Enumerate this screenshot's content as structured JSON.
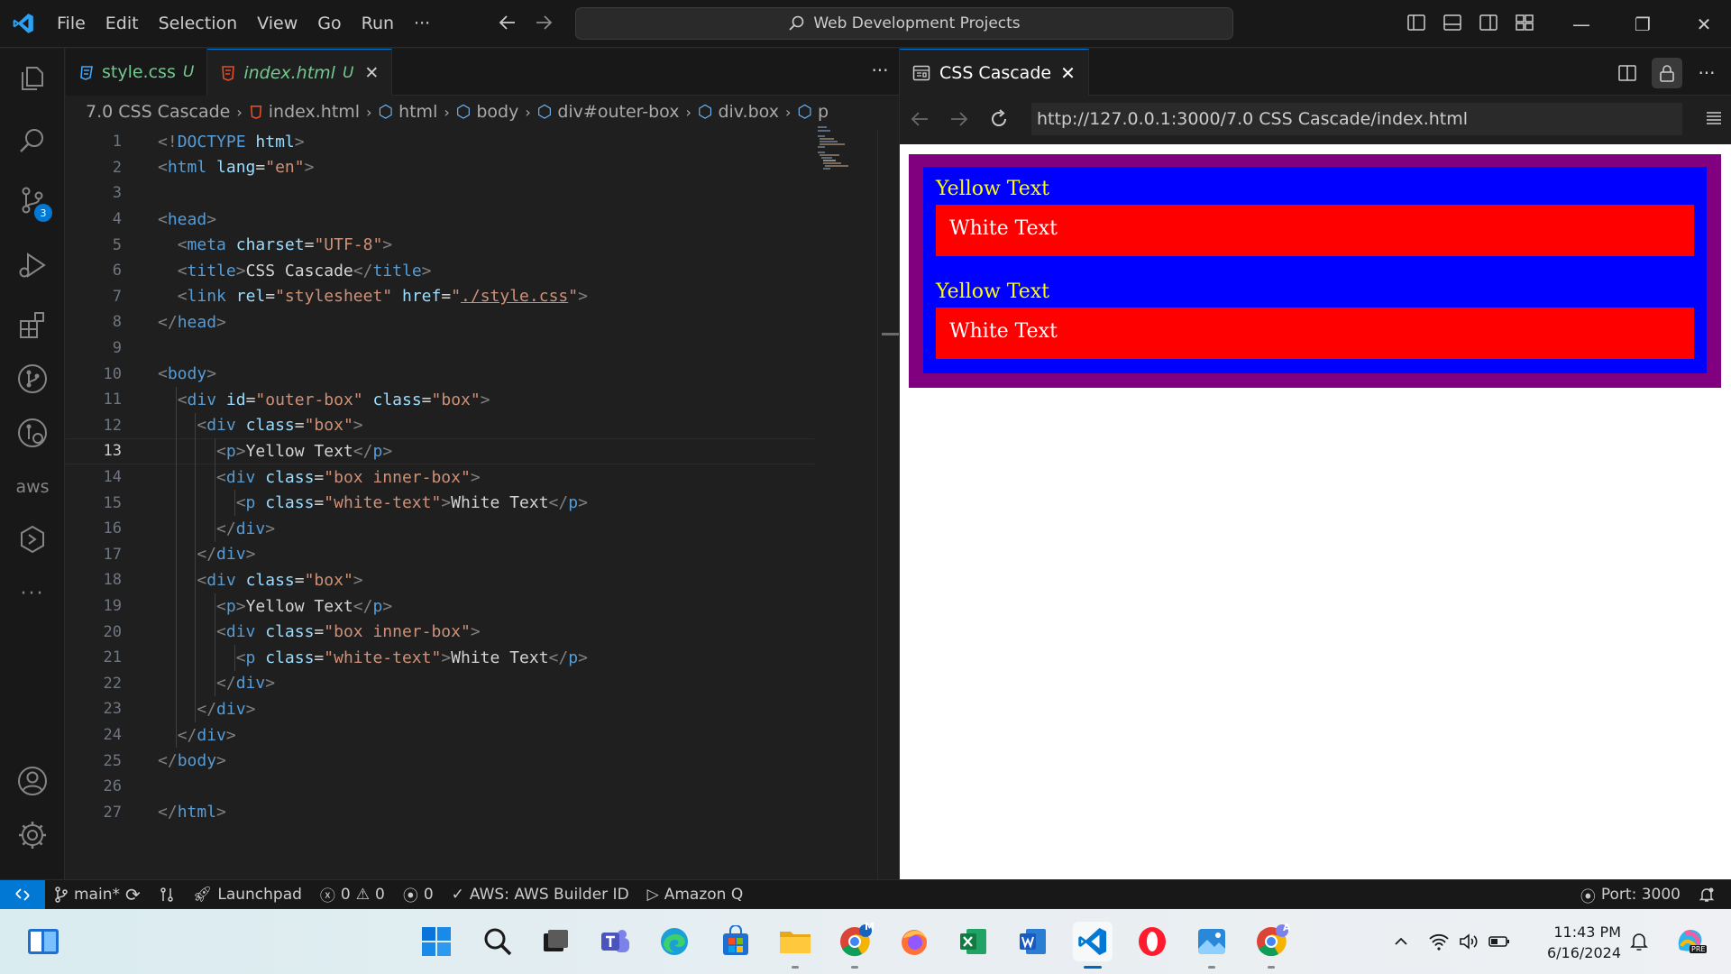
{
  "titlebar": {
    "menu": [
      "File",
      "Edit",
      "Selection",
      "View",
      "Go",
      "Run",
      "···"
    ],
    "command_center": "Web Development Projects"
  },
  "activity_bar": {
    "items": [
      "explorer-icon",
      "search-icon",
      "source-control-icon",
      "run-debug-icon",
      "extensions-icon",
      "git-graph-icon",
      "remote-explorer-icon",
      "aws-icon",
      "hexagon-icon",
      "more-icon"
    ],
    "aws_label": "aws",
    "source_control_badge": "3",
    "bottom": [
      "accounts-icon",
      "settings-icon"
    ]
  },
  "editor": {
    "tabs": [
      {
        "label": "style.css",
        "status": "U",
        "icon": "css-file-icon"
      },
      {
        "label": "index.html",
        "status": "U",
        "icon": "html-file-icon"
      }
    ],
    "breadcrumb": [
      "7.0 CSS Cascade",
      "index.html",
      "html",
      "body",
      "div#outer-box",
      "div.box",
      "p"
    ],
    "current_line": 13,
    "lines": [
      [
        {
          "t": "br",
          "v": "<!"
        },
        {
          "t": "tag",
          "v": "DOCTYPE"
        },
        {
          "t": "txt",
          "v": " "
        },
        {
          "t": "attr",
          "v": "html"
        },
        {
          "t": "br",
          "v": ">"
        }
      ],
      [
        {
          "t": "br",
          "v": "<"
        },
        {
          "t": "tag",
          "v": "html"
        },
        {
          "t": "txt",
          "v": " "
        },
        {
          "t": "attr",
          "v": "lang"
        },
        {
          "t": "txt",
          "v": "="
        },
        {
          "t": "str",
          "v": "\"en\""
        },
        {
          "t": "br",
          "v": ">"
        }
      ],
      [],
      [
        {
          "t": "br",
          "v": "<"
        },
        {
          "t": "tag",
          "v": "head"
        },
        {
          "t": "br",
          "v": ">"
        }
      ],
      [
        {
          "t": "txt",
          "v": "  "
        },
        {
          "t": "br",
          "v": "<"
        },
        {
          "t": "tag",
          "v": "meta"
        },
        {
          "t": "txt",
          "v": " "
        },
        {
          "t": "attr",
          "v": "charset"
        },
        {
          "t": "txt",
          "v": "="
        },
        {
          "t": "str",
          "v": "\"UTF-8\""
        },
        {
          "t": "br",
          "v": ">"
        }
      ],
      [
        {
          "t": "txt",
          "v": "  "
        },
        {
          "t": "br",
          "v": "<"
        },
        {
          "t": "tag",
          "v": "title"
        },
        {
          "t": "br",
          "v": ">"
        },
        {
          "t": "txt",
          "v": "CSS Cascade"
        },
        {
          "t": "br",
          "v": "</"
        },
        {
          "t": "tag",
          "v": "title"
        },
        {
          "t": "br",
          "v": ">"
        }
      ],
      [
        {
          "t": "txt",
          "v": "  "
        },
        {
          "t": "br",
          "v": "<"
        },
        {
          "t": "tag",
          "v": "link"
        },
        {
          "t": "txt",
          "v": " "
        },
        {
          "t": "attr",
          "v": "rel"
        },
        {
          "t": "txt",
          "v": "="
        },
        {
          "t": "str",
          "v": "\"stylesheet\""
        },
        {
          "t": "txt",
          "v": " "
        },
        {
          "t": "attr",
          "v": "href"
        },
        {
          "t": "txt",
          "v": "="
        },
        {
          "t": "str",
          "v": "\""
        },
        {
          "t": "link",
          "v": "./style.css"
        },
        {
          "t": "str",
          "v": "\""
        },
        {
          "t": "br",
          "v": ">"
        }
      ],
      [
        {
          "t": "br",
          "v": "</"
        },
        {
          "t": "tag",
          "v": "head"
        },
        {
          "t": "br",
          "v": ">"
        }
      ],
      [],
      [
        {
          "t": "br",
          "v": "<"
        },
        {
          "t": "tag",
          "v": "body"
        },
        {
          "t": "br",
          "v": ">"
        }
      ],
      [
        {
          "t": "txt",
          "v": "  "
        },
        {
          "t": "br",
          "v": "<"
        },
        {
          "t": "tag",
          "v": "div"
        },
        {
          "t": "txt",
          "v": " "
        },
        {
          "t": "attr",
          "v": "id"
        },
        {
          "t": "txt",
          "v": "="
        },
        {
          "t": "str",
          "v": "\"outer-box\""
        },
        {
          "t": "txt",
          "v": " "
        },
        {
          "t": "attr",
          "v": "class"
        },
        {
          "t": "txt",
          "v": "="
        },
        {
          "t": "str",
          "v": "\"box\""
        },
        {
          "t": "br",
          "v": ">"
        }
      ],
      [
        {
          "t": "txt",
          "v": "    "
        },
        {
          "t": "br",
          "v": "<"
        },
        {
          "t": "tag",
          "v": "div"
        },
        {
          "t": "txt",
          "v": " "
        },
        {
          "t": "attr",
          "v": "class"
        },
        {
          "t": "txt",
          "v": "="
        },
        {
          "t": "str",
          "v": "\"box\""
        },
        {
          "t": "br",
          "v": ">"
        }
      ],
      [
        {
          "t": "txt",
          "v": "      "
        },
        {
          "t": "br",
          "v": "<"
        },
        {
          "t": "tag",
          "v": "p"
        },
        {
          "t": "br",
          "v": ">"
        },
        {
          "t": "txt",
          "v": "Yellow Text"
        },
        {
          "t": "br",
          "v": "</"
        },
        {
          "t": "tag",
          "v": "p"
        },
        {
          "t": "br",
          "v": ">"
        }
      ],
      [
        {
          "t": "txt",
          "v": "      "
        },
        {
          "t": "br",
          "v": "<"
        },
        {
          "t": "tag",
          "v": "div"
        },
        {
          "t": "txt",
          "v": " "
        },
        {
          "t": "attr",
          "v": "class"
        },
        {
          "t": "txt",
          "v": "="
        },
        {
          "t": "str",
          "v": "\"box inner-box\""
        },
        {
          "t": "br",
          "v": ">"
        }
      ],
      [
        {
          "t": "txt",
          "v": "        "
        },
        {
          "t": "br",
          "v": "<"
        },
        {
          "t": "tag",
          "v": "p"
        },
        {
          "t": "txt",
          "v": " "
        },
        {
          "t": "attr",
          "v": "class"
        },
        {
          "t": "txt",
          "v": "="
        },
        {
          "t": "str",
          "v": "\"white-text\""
        },
        {
          "t": "br",
          "v": ">"
        },
        {
          "t": "txt",
          "v": "White Text"
        },
        {
          "t": "br",
          "v": "</"
        },
        {
          "t": "tag",
          "v": "p"
        },
        {
          "t": "br",
          "v": ">"
        }
      ],
      [
        {
          "t": "txt",
          "v": "      "
        },
        {
          "t": "br",
          "v": "</"
        },
        {
          "t": "tag",
          "v": "div"
        },
        {
          "t": "br",
          "v": ">"
        }
      ],
      [
        {
          "t": "txt",
          "v": "    "
        },
        {
          "t": "br",
          "v": "</"
        },
        {
          "t": "tag",
          "v": "div"
        },
        {
          "t": "br",
          "v": ">"
        }
      ],
      [
        {
          "t": "txt",
          "v": "    "
        },
        {
          "t": "br",
          "v": "<"
        },
        {
          "t": "tag",
          "v": "div"
        },
        {
          "t": "txt",
          "v": " "
        },
        {
          "t": "attr",
          "v": "class"
        },
        {
          "t": "txt",
          "v": "="
        },
        {
          "t": "str",
          "v": "\"box\""
        },
        {
          "t": "br",
          "v": ">"
        }
      ],
      [
        {
          "t": "txt",
          "v": "      "
        },
        {
          "t": "br",
          "v": "<"
        },
        {
          "t": "tag",
          "v": "p"
        },
        {
          "t": "br",
          "v": ">"
        },
        {
          "t": "txt",
          "v": "Yellow Text"
        },
        {
          "t": "br",
          "v": "</"
        },
        {
          "t": "tag",
          "v": "p"
        },
        {
          "t": "br",
          "v": ">"
        }
      ],
      [
        {
          "t": "txt",
          "v": "      "
        },
        {
          "t": "br",
          "v": "<"
        },
        {
          "t": "tag",
          "v": "div"
        },
        {
          "t": "txt",
          "v": " "
        },
        {
          "t": "attr",
          "v": "class"
        },
        {
          "t": "txt",
          "v": "="
        },
        {
          "t": "str",
          "v": "\"box inner-box\""
        },
        {
          "t": "br",
          "v": ">"
        }
      ],
      [
        {
          "t": "txt",
          "v": "        "
        },
        {
          "t": "br",
          "v": "<"
        },
        {
          "t": "tag",
          "v": "p"
        },
        {
          "t": "txt",
          "v": " "
        },
        {
          "t": "attr",
          "v": "class"
        },
        {
          "t": "txt",
          "v": "="
        },
        {
          "t": "str",
          "v": "\"white-text\""
        },
        {
          "t": "br",
          "v": ">"
        },
        {
          "t": "txt",
          "v": "White Text"
        },
        {
          "t": "br",
          "v": "</"
        },
        {
          "t": "tag",
          "v": "p"
        },
        {
          "t": "br",
          "v": ">"
        }
      ],
      [
        {
          "t": "txt",
          "v": "      "
        },
        {
          "t": "br",
          "v": "</"
        },
        {
          "t": "tag",
          "v": "div"
        },
        {
          "t": "br",
          "v": ">"
        }
      ],
      [
        {
          "t": "txt",
          "v": "    "
        },
        {
          "t": "br",
          "v": "</"
        },
        {
          "t": "tag",
          "v": "div"
        },
        {
          "t": "br",
          "v": ">"
        }
      ],
      [
        {
          "t": "txt",
          "v": "  "
        },
        {
          "t": "br",
          "v": "</"
        },
        {
          "t": "tag",
          "v": "div"
        },
        {
          "t": "br",
          "v": ">"
        }
      ],
      [
        {
          "t": "br",
          "v": "</"
        },
        {
          "t": "tag",
          "v": "body"
        },
        {
          "t": "br",
          "v": ">"
        }
      ],
      [],
      [
        {
          "t": "br",
          "v": "</"
        },
        {
          "t": "tag",
          "v": "html"
        },
        {
          "t": "br",
          "v": ">"
        }
      ]
    ]
  },
  "browser": {
    "tab_label": "CSS Cascade",
    "url": "http://127.0.0.1:3000/7.0 CSS Cascade/index.html",
    "page": {
      "blocks": [
        {
          "yellow": "Yellow Text",
          "white": "White Text"
        },
        {
          "yellow": "Yellow Text",
          "white": "White Text"
        }
      ],
      "colors": {
        "outer": "#800080",
        "box": "#0000ff",
        "inner": "#ff0000",
        "yellow": "#ffff00",
        "white": "#ffffff"
      }
    }
  },
  "statusbar": {
    "branch": "main*",
    "launchpad": "Launchpad",
    "errors": "0",
    "warnings": "0",
    "ports": "0",
    "aws": "AWS: AWS Builder ID",
    "amazon_q": "Amazon Q",
    "port": "Port: 3000"
  },
  "taskbar": {
    "apps": [
      "windows-start-icon",
      "search-icon",
      "task-view-icon",
      "teams-icon",
      "edge-icon",
      "store-icon",
      "file-explorer-icon",
      "chrome-icon",
      "firefox-icon",
      "excel-icon",
      "word-icon",
      "vscode-icon",
      "opera-icon",
      "photos-icon",
      "chrome-profile-icon"
    ],
    "chrome_badge_m": "M",
    "chrome_badge_a": "A",
    "time": "11:43 PM",
    "date": "6/16/2024",
    "copilot_badge": "PRE"
  }
}
